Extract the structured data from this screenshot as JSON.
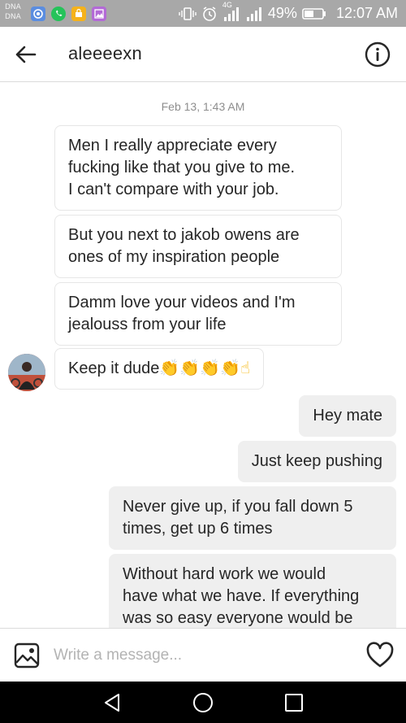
{
  "status_bar": {
    "carrier_top": "DNA",
    "carrier_bottom": "DNA",
    "network": "4G",
    "battery": "49%",
    "time": "12:07 AM"
  },
  "header": {
    "username": "aleeeexn",
    "back_icon": "arrow-left-icon",
    "info_icon": "info-icon"
  },
  "chat": {
    "date": "Feb 13, 1:43 AM",
    "messages": [
      {
        "direction": "incoming",
        "lines": [
          "Men I really appreciate every",
          "fucking like that you give to me.",
          "I can't compare with your job."
        ]
      },
      {
        "direction": "incoming",
        "lines": [
          "But you next to jakob owens are",
          "ones of my inspiration people"
        ]
      },
      {
        "direction": "incoming",
        "lines": [
          "Damm love your videos and I'm",
          "jealouss from your life"
        ]
      },
      {
        "direction": "incoming",
        "lines": [
          "Keep it dude"
        ],
        "emoji": "👏👏👏👏☝"
      },
      {
        "direction": "outgoing",
        "lines": [
          "Hey mate"
        ]
      },
      {
        "direction": "outgoing",
        "lines": [
          "Just keep pushing"
        ]
      },
      {
        "direction": "outgoing",
        "lines": [
          "Never give up, if you fall down 5",
          "times, get up 6 times"
        ]
      },
      {
        "direction": "outgoing",
        "lines": [
          "Without hard work we would",
          "have what we have. If everything",
          "was so easy everyone would be"
        ]
      }
    ]
  },
  "composer": {
    "placeholder": "Write a message...",
    "gallery_icon": "image-icon",
    "heart_icon": "heart-icon"
  },
  "nav": {
    "back_icon": "triangle-back-icon",
    "home_icon": "circle-home-icon",
    "recent_icon": "square-recent-icon"
  },
  "colors": {
    "status_bar": "#a8a8a8",
    "outgoing_bubble": "#efefef",
    "incoming_border": "#e6e6e6",
    "navbar": "#000000"
  }
}
